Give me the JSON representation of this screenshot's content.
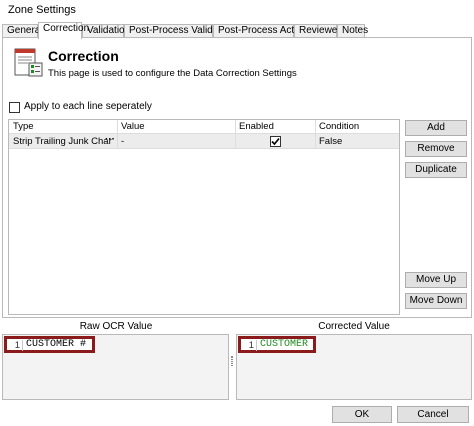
{
  "window": {
    "title": "Zone Settings"
  },
  "tabs": [
    "General",
    "Correction",
    "Validation",
    "Post-Process Validation",
    "Post-Process Actions",
    "Reviewer",
    "Notes"
  ],
  "active_tab": "Correction",
  "header": {
    "title": "Correction",
    "subtitle": "This page is used to configure the Data Correction Settings"
  },
  "apply_each_line": {
    "label": "Apply to each line seperately",
    "checked": false
  },
  "grid": {
    "columns": [
      "Type",
      "Value",
      "Enabled",
      "Condition"
    ],
    "rows": [
      {
        "type": "Strip Trailing Junk Char",
        "value": "-",
        "enabled": true,
        "condition": "False"
      }
    ]
  },
  "buttons": {
    "add": "Add",
    "remove": "Remove",
    "duplicate": "Duplicate",
    "move_up": "Move Up",
    "move_down": "Move Down",
    "ok": "OK",
    "cancel": "Cancel"
  },
  "raw": {
    "label": "Raw OCR Value",
    "line": "1",
    "value": "CUSTOMER #"
  },
  "corrected": {
    "label": "Corrected Value",
    "line": "1",
    "value": "CUSTOMER"
  },
  "colors": {
    "accent_red": "#8b1a1a",
    "corrected_text": "#1f8a1f"
  }
}
